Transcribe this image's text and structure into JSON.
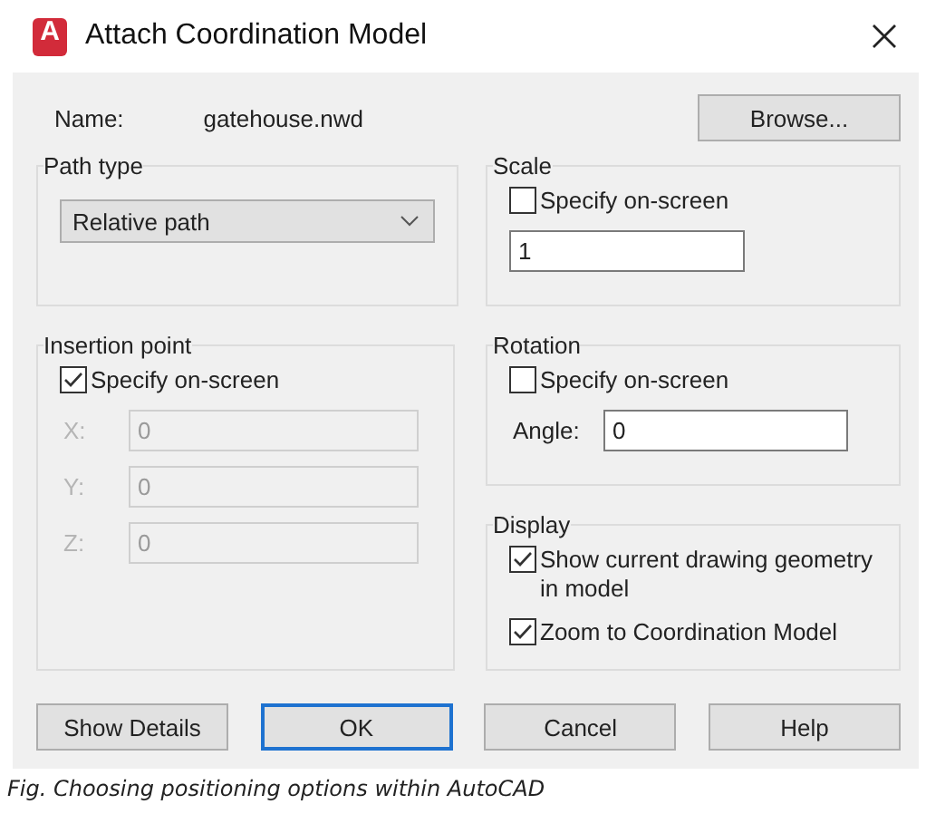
{
  "window": {
    "logo": "A",
    "title": "Attach Coordination Model"
  },
  "name": {
    "label": "Name:",
    "value": "gatehouse.nwd"
  },
  "browse_button": "Browse...",
  "path_type": {
    "title": "Path type",
    "dropdown": {
      "value": "Relative path"
    }
  },
  "scale": {
    "title": "Scale",
    "specify": {
      "label": "Specify on-screen",
      "checked": false
    },
    "value": "1"
  },
  "insertion_point": {
    "title": "Insertion point",
    "specify": {
      "label": "Specify on-screen",
      "checked": true
    },
    "fields": [
      {
        "label": "X:",
        "value": "0",
        "disabled": true
      },
      {
        "label": "Y:",
        "value": "0",
        "disabled": true
      },
      {
        "label": "Z:",
        "value": "0",
        "disabled": true
      }
    ]
  },
  "rotation": {
    "title": "Rotation",
    "specify": {
      "label": "Specify on-screen",
      "checked": false
    },
    "angle": {
      "label": "Angle:",
      "value": "0"
    }
  },
  "display": {
    "title": "Display",
    "options": [
      {
        "label": "Show current drawing geometry in model",
        "checked": true
      },
      {
        "label": "Zoom to Coordination Model",
        "checked": true
      }
    ]
  },
  "buttons": [
    {
      "label": "Show Details",
      "default": false
    },
    {
      "label": "OK",
      "default": true
    },
    {
      "label": "Cancel",
      "default": false
    },
    {
      "label": "Help",
      "default": false
    }
  ],
  "caption": "Fig. Choosing positioning options within AutoCAD"
}
